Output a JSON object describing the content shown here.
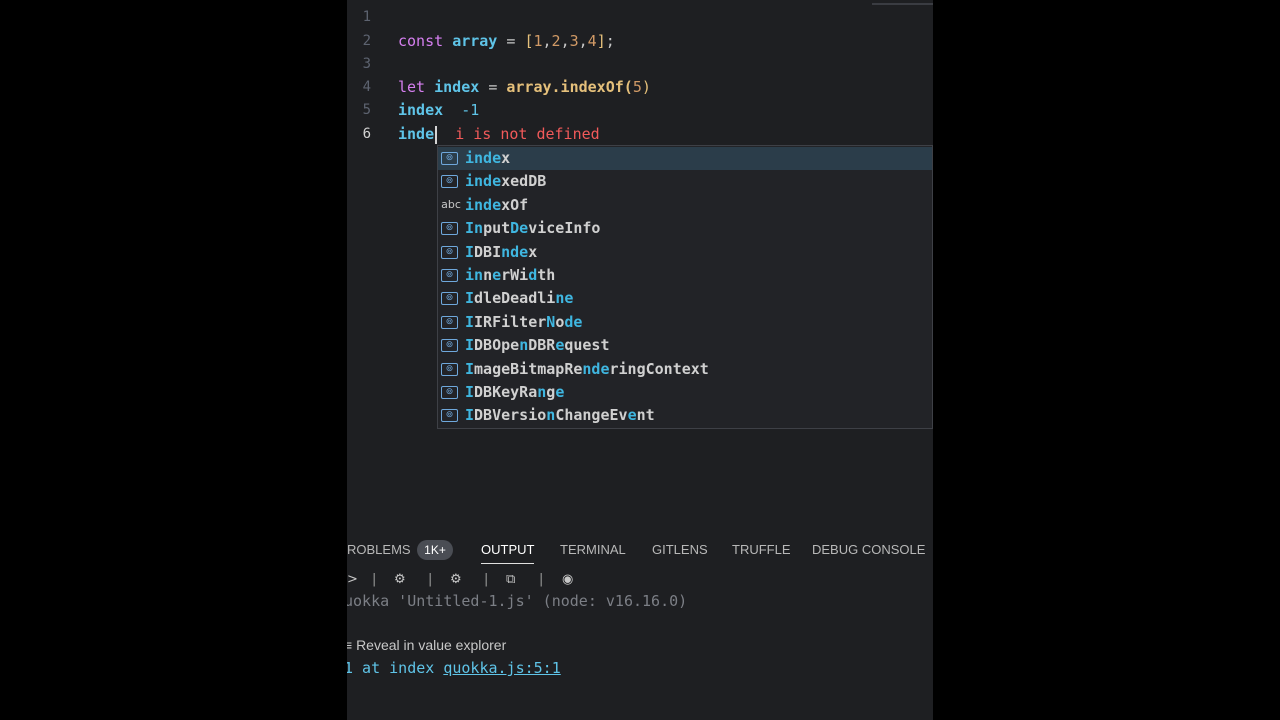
{
  "editor": {
    "lines": [
      {
        "num": "1"
      },
      {
        "num": "2",
        "tokens": [
          "const",
          "array",
          "=",
          "[",
          "1",
          ",",
          "2",
          ",",
          "3",
          ",",
          "4",
          "]",
          ";"
        ]
      },
      {
        "num": "3"
      },
      {
        "num": "4",
        "tokens": [
          "let",
          "index",
          "=",
          "array",
          ".indexOf(",
          "5",
          ")"
        ]
      },
      {
        "num": "5",
        "code": "index",
        "inline_value": "-1"
      },
      {
        "num": "6",
        "code": "inde",
        "error": "i is not defined"
      }
    ]
  },
  "suggest": {
    "items": [
      {
        "icon": "variable",
        "parts": [
          [
            "inde",
            true
          ],
          [
            "x",
            false
          ]
        ]
      },
      {
        "icon": "variable",
        "parts": [
          [
            "inde",
            true
          ],
          [
            "xedDB",
            false
          ]
        ]
      },
      {
        "icon": "text",
        "icon_text": "abc",
        "parts": [
          [
            "inde",
            true
          ],
          [
            "xOf",
            false
          ]
        ]
      },
      {
        "icon": "variable",
        "parts": [
          [
            "In",
            true
          ],
          [
            "put",
            false
          ],
          [
            "De",
            true
          ],
          [
            "viceInfo",
            false
          ]
        ]
      },
      {
        "icon": "variable",
        "parts": [
          [
            "I",
            true
          ],
          [
            "DBI",
            false
          ],
          [
            "nde",
            true
          ],
          [
            "x",
            false
          ]
        ]
      },
      {
        "icon": "variable",
        "parts": [
          [
            "in",
            true
          ],
          [
            "n",
            false
          ],
          [
            "e",
            true
          ],
          [
            "rWi",
            false
          ],
          [
            "d",
            true
          ],
          [
            "th",
            false
          ]
        ]
      },
      {
        "icon": "variable",
        "parts": [
          [
            "I",
            true
          ],
          [
            "dleDeadli",
            false
          ],
          [
            "ne",
            true
          ]
        ]
      },
      {
        "icon": "variable",
        "parts": [
          [
            "I",
            true
          ],
          [
            "IRFilter",
            false
          ],
          [
            "N",
            true
          ],
          [
            "o",
            false
          ],
          [
            "de",
            true
          ]
        ]
      },
      {
        "icon": "variable",
        "parts": [
          [
            "I",
            true
          ],
          [
            "DBOpe",
            false
          ],
          [
            "n",
            true
          ],
          [
            "DBR",
            false
          ],
          [
            "e",
            true
          ],
          [
            "quest",
            false
          ]
        ]
      },
      {
        "icon": "variable",
        "parts": [
          [
            "I",
            true
          ],
          [
            "mageBitmapRe",
            false
          ],
          [
            "nde",
            true
          ],
          [
            "ringContext",
            false
          ]
        ]
      },
      {
        "icon": "variable",
        "parts": [
          [
            "I",
            true
          ],
          [
            "DBKeyRa",
            false
          ],
          [
            "n",
            true
          ],
          [
            "g",
            false
          ],
          [
            "e",
            true
          ]
        ]
      },
      {
        "icon": "variable",
        "parts": [
          [
            "I",
            true
          ],
          [
            "DBVersio",
            false
          ],
          [
            "n",
            true
          ],
          [
            "ChangeEv",
            false
          ],
          [
            "e",
            true
          ],
          [
            "nt",
            false
          ]
        ]
      }
    ]
  },
  "panel": {
    "tabs": [
      "ROBLEMS",
      "OUTPUT",
      "TERMINAL",
      "GITLENS",
      "TRUFFLE",
      "DEBUG CONSOLE"
    ],
    "badge": "1K+",
    "active_tab": "OUTPUT",
    "toolbar": {
      "play": ">",
      "sep": "|",
      "bug": "⚙",
      "gear": "⚙",
      "copy": "⧉",
      "circle": "◉"
    },
    "output": {
      "run_line": "uokka 'Untitled-1.js' (node: v16.16.0)",
      "reveal_prefix": "≡",
      "reveal": "Reveal in value explorer",
      "result_text": "1 at index ",
      "result_link": "quokka.js:5:1"
    }
  },
  "colors": {
    "editor_bg": "#1e1f22",
    "accent": "#3fb6e0",
    "error": "#f25a5a"
  }
}
